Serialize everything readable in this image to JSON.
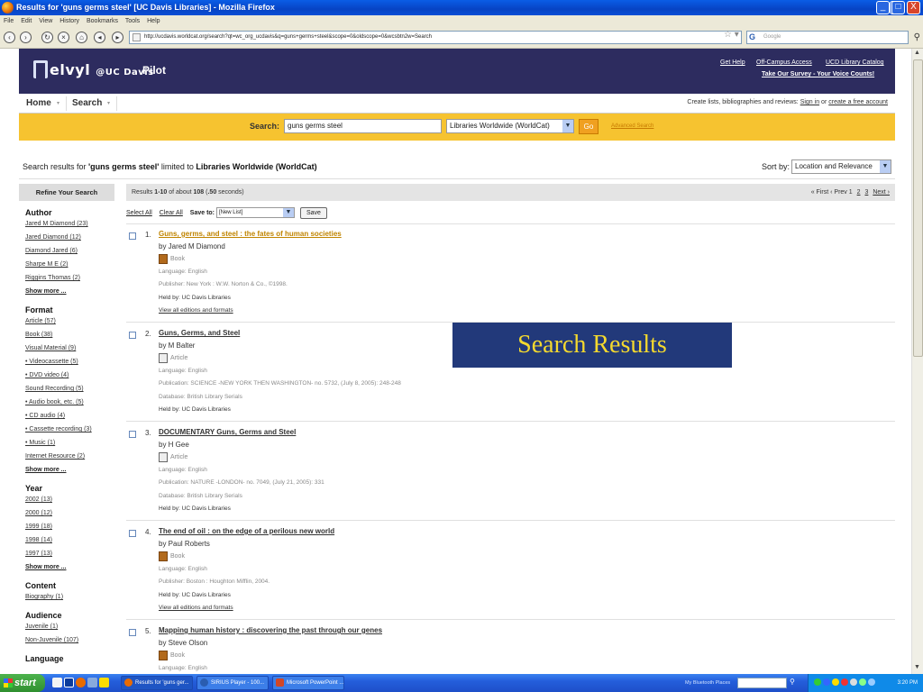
{
  "window": {
    "title": "Results for 'guns germs steel' [UC Davis Libraries] - Mozilla Firefox",
    "controls": [
      "_",
      "□",
      "X"
    ]
  },
  "menu": [
    "File",
    "Edit",
    "View",
    "History",
    "Bookmarks",
    "Tools",
    "Help"
  ],
  "browser": {
    "url": "http://ucdavis.worldcat.org/search?qt=wc_org_ucdavis&q=guns+germs+steel&scope=0&oldscope=0&wcsbtn2w=Search",
    "search_placeholder": "Google"
  },
  "header": {
    "logo_main": "elvyl",
    "logo_suffix": "@UC Davis",
    "pilot": "Pilot",
    "links": [
      "Get Help",
      "Off-Campus Access",
      "UCD Library Catalog"
    ],
    "survey": "Take Our Survey - Your Voice Counts!"
  },
  "tabs": {
    "home": "Home",
    "search": "Search",
    "create_prefix": "Create lists, bibliographies and reviews:",
    "sign_in": "Sign in",
    "or": "or",
    "create_account": "create a free account"
  },
  "searchbar": {
    "label": "Search:",
    "query": "guns germs steel",
    "scope": "Libraries Worldwide (WorldCat)",
    "go": "Go",
    "advanced": "Advanced Search"
  },
  "results_header": {
    "prefix": "Search results for",
    "query": "'guns germs steel'",
    "limited": "limited to",
    "scope": "Libraries Worldwide (WorldCat)",
    "sort_label": "Sort by:",
    "sort_value": "Location and Relevance"
  },
  "sidebar": {
    "title": "Refine Your Search",
    "facets": [
      {
        "name": "Author",
        "items": [
          "Jared M Diamond (23)",
          "Jared Diamond (12)",
          "Diamond Jared (6)",
          "Sharpe M E (2)",
          "Riggins Thomas (2)"
        ],
        "more": "Show more ..."
      },
      {
        "name": "Format",
        "items": [
          "Article (57)",
          "Book (38)",
          "Visual Material (9)",
          "• Videocassette (5)",
          "• DVD video (4)",
          "Sound Recording (5)",
          "• Audio book, etc. (5)",
          "• CD audio (4)",
          "• Cassette recording (3)",
          "• Music (1)",
          "Internet Resource (2)"
        ],
        "more": "Show more ..."
      },
      {
        "name": "Year",
        "items": [
          "2002 (13)",
          "2000 (12)",
          "1999 (18)",
          "1998 (14)",
          "1997 (13)"
        ],
        "more": "Show more ..."
      },
      {
        "name": "Content",
        "items": [
          "Biography (1)"
        ]
      },
      {
        "name": "Audience",
        "items": [
          "Juvenile (1)",
          "Non-Juvenile (107)"
        ]
      },
      {
        "name": "Language",
        "items": []
      }
    ]
  },
  "main": {
    "results_text": "Results 1-10 of about 108 (.50 seconds)",
    "pager": {
      "first": "« First",
      "prev": "‹ Prev",
      "pages": [
        "1",
        "2",
        "3"
      ],
      "next": "Next ›"
    },
    "select_all": "Select All",
    "clear_all": "Clear All",
    "save_to": "Save to:",
    "save_list": "[New List]",
    "save_button": "Save",
    "results": [
      {
        "num": "1.",
        "title": "Guns, germs, and steel : the fates of human societies",
        "by": "by Jared M Diamond",
        "type": "Book",
        "lines": [
          "Language: English",
          "Publisher: New York : W.W. Norton & Co., ©1998.",
          "Held by: UC Davis Libraries",
          "View all editions and formats"
        ]
      },
      {
        "num": "2.",
        "title": "Guns, Germs, and Steel",
        "by": "by M Balter",
        "type": "Article",
        "lines": [
          "Language: English",
          "Publication: SCIENCE -NEW YORK THEN WASHINGTON- no. 5732, (July 8, 2005): 248-248",
          "Database: British Library Serials",
          "Held by: UC Davis Libraries"
        ]
      },
      {
        "num": "3.",
        "title": "DOCUMENTARY Guns, Germs and Steel",
        "by": "by H Gee",
        "type": "Article",
        "lines": [
          "Language: English",
          "Publication: NATURE -LONDON- no. 7049, (July 21, 2005): 331",
          "Database: British Library Serials",
          "Held by: UC Davis Libraries"
        ]
      },
      {
        "num": "4.",
        "title": "The end of oil : on the edge of a perilous new world",
        "by": "by Paul Roberts",
        "type": "Book",
        "lines": [
          "Language: English",
          "Publisher: Boston : Houghton Mifflin, 2004.",
          "Held by: UC Davis Libraries",
          "View all editions and formats"
        ]
      },
      {
        "num": "5.",
        "title": "Mapping human history : discovering the past through our genes",
        "by": "by Steve Olson",
        "type": "Book",
        "lines": [
          "Language: English"
        ]
      }
    ]
  },
  "overlay": "Search Results",
  "taskbar": {
    "start": "start",
    "tasks": [
      "Results for 'guns ger...",
      "SIRIUS Player - 100...",
      "Microsoft PowerPoint ..."
    ],
    "bluetooth": "My Bluetooth Places",
    "clock": "3:20 PM"
  },
  "colors": {
    "header": "#2d2c5f",
    "searchbar": "#f6c330",
    "overlay_bg": "#22397a",
    "overlay_text": "#f4d92e",
    "first_title": "#c08400"
  }
}
